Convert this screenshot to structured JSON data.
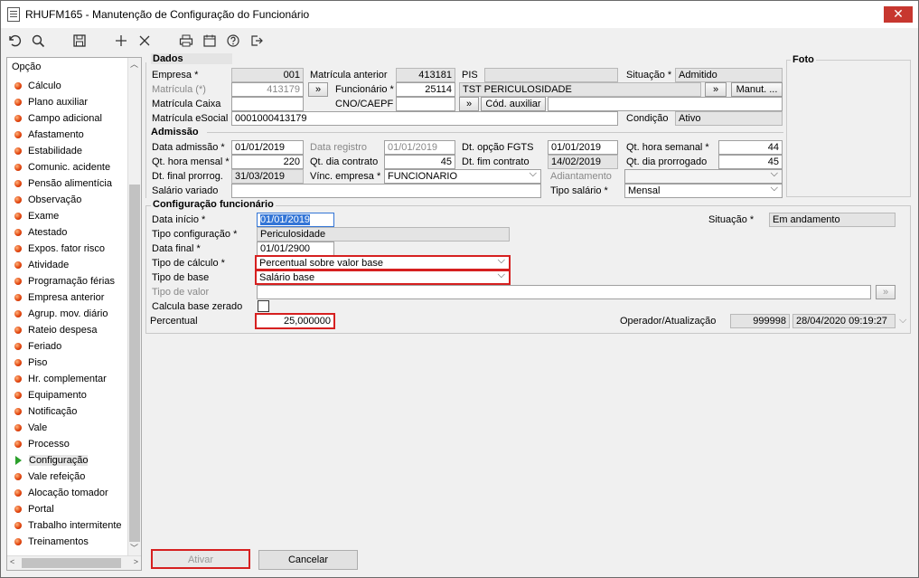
{
  "window": {
    "title": "RHUFM165 - Manutenção de Configuração do Funcionário",
    "close": "✕"
  },
  "sidebar": {
    "header": "Opção",
    "items": [
      "Cálculo",
      "Plano auxiliar",
      "Campo adicional",
      "Afastamento",
      "Estabilidade",
      "Comunic. acidente",
      "Pensão alimentícia",
      "Observação",
      "Exame",
      "Atestado",
      "Expos. fator risco",
      "Atividade",
      "Programação férias",
      "Empresa anterior",
      "Agrup. mov. diário",
      "Rateio despesa",
      "Feriado",
      "Piso",
      "Hr. complementar",
      "Equipamento",
      "Notificação",
      "Vale",
      "Processo",
      "Configuração",
      "Vale refeição",
      "Alocação tomador",
      "Portal",
      "Trabalho intermitente",
      "Treinamentos"
    ],
    "selected_index": 23
  },
  "dados": {
    "title": "Dados",
    "foto_label": "Foto",
    "empresa_label": "Empresa *",
    "empresa": "001",
    "matricula_label": "Matrícula (*)",
    "matricula": "413179",
    "matricula_caixa_label": "Matrícula Caixa",
    "matricula_caixa": "",
    "matricula_esocial_label": "Matrícula eSocial",
    "matricula_esocial": "0001000413179",
    "matricula_anterior_label": "Matrícula anterior",
    "matricula_anterior": "413181",
    "funcionario_label": "Funcionário *",
    "funcionario": "25114",
    "funcionario_nome": "TST PERICULOSIDADE",
    "cno_label": "CNO/CAEPF",
    "cno": "",
    "pis_label": "PIS",
    "pis": "",
    "situacao_label": "Situação *",
    "situacao": "Admitido",
    "condicao_label": "Condição",
    "condicao": "Ativo",
    "lookup_btn": "»",
    "manut_btn": "Manut. ...",
    "cod_auxiliar_btn": "Cód. auxiliar"
  },
  "admissao": {
    "title": "Admissão",
    "data_admissao_label": "Data admissão *",
    "data_admissao": "01/01/2019",
    "data_registro_label": "Data registro",
    "data_registro": "01/01/2019",
    "dt_opcao_fgts_label": "Dt. opção FGTS",
    "dt_opcao_fgts": "01/01/2019",
    "qt_hora_semanal_label": "Qt. hora semanal *",
    "qt_hora_semanal": "44",
    "qt_hora_mensal_label": "Qt. hora mensal *",
    "qt_hora_mensal": "220",
    "qt_dia_contrato_label": "Qt. dia contrato",
    "qt_dia_contrato": "45",
    "dt_fim_contrato_label": "Dt. fim contrato",
    "dt_fim_contrato": "14/02/2019",
    "qt_dia_prorrogado_label": "Qt. dia prorrogado",
    "qt_dia_prorrogado": "45",
    "dt_final_prorrog_label": "Dt. final prorrog.",
    "dt_final_prorrog": "31/03/2019",
    "vinc_empresa_label": "Vínc. empresa *",
    "vinc_empresa": "FUNCIONARIO",
    "adiantamento_label": "Adiantamento",
    "adiantamento": "",
    "salario_variado_label": "Salário variado",
    "salario_variado": "",
    "tipo_salario_label": "Tipo salário *",
    "tipo_salario": "Mensal"
  },
  "config": {
    "title": "Configuração funcionário",
    "data_inicio_label": "Data início *",
    "data_inicio": "01/01/2019",
    "tipo_configuracao_label": "Tipo configuração *",
    "tipo_configuracao": "Periculosidade",
    "data_final_label": "Data final *",
    "data_final": "01/01/2900",
    "tipo_calculo_label": "Tipo de cálculo *",
    "tipo_calculo": "Percentual sobre valor base",
    "tipo_base_label": "Tipo de base",
    "tipo_base": "Salário base",
    "tipo_valor_label": "Tipo de valor",
    "tipo_valor": "",
    "calcula_base_zerado_label": "Calcula base zerado",
    "percentual_label": "Percentual",
    "percentual": "25,000000",
    "situacao_label": "Situação *",
    "situacao": "Em andamento",
    "operador_label": "Operador/Atualização",
    "operador": "999998",
    "atualizacao": "28/04/2020 09:19:27",
    "tipo_valor_btn": "»"
  },
  "footer": {
    "ativar": "Ativar",
    "cancelar": "Cancelar"
  },
  "colors": {
    "highlight_red": "#d62020",
    "readonly_bg": "#e4e4e4",
    "selection_blue": "#3375d6"
  }
}
